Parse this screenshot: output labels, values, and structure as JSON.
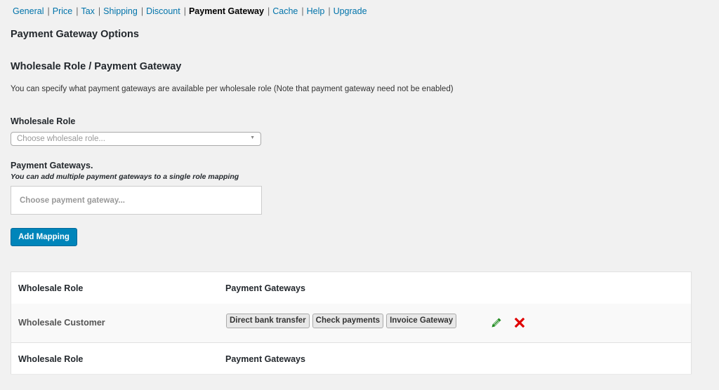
{
  "subnav": {
    "items": [
      {
        "label": "General",
        "current": false
      },
      {
        "label": "Price",
        "current": false
      },
      {
        "label": "Tax",
        "current": false
      },
      {
        "label": "Shipping",
        "current": false
      },
      {
        "label": "Discount",
        "current": false
      },
      {
        "label": "Payment Gateway",
        "current": true
      },
      {
        "label": "Cache",
        "current": false
      },
      {
        "label": "Help",
        "current": false
      },
      {
        "label": "Upgrade",
        "current": false
      }
    ],
    "separator": "|"
  },
  "page": {
    "title": "Payment Gateway Options",
    "section_title": "Wholesale Role / Payment Gateway",
    "description": "You can specify what payment gateways are available per wholesale role (Note that payment gateway need not be enabled)"
  },
  "form": {
    "role_label": "Wholesale Role",
    "role_placeholder": "Choose wholesale role...",
    "gateways_label": "Payment Gateways.",
    "gateways_hint": "You can add multiple payment gateways to a single role mapping",
    "gateways_placeholder": "Choose payment gateway...",
    "add_button": "Add Mapping"
  },
  "table": {
    "columns": [
      "Wholesale Role",
      "Payment Gateways"
    ],
    "rows": [
      {
        "role": "Wholesale Customer",
        "gateways": [
          "Direct bank transfer",
          "Check payments",
          "Invoice Gateway"
        ],
        "actions": [
          "edit-icon",
          "delete-icon"
        ]
      }
    ],
    "footer_columns": [
      "Wholesale Role",
      "Payment Gateways"
    ]
  },
  "colors": {
    "link": "#0073aa",
    "primary_button": "#0085ba",
    "edit_icon": "#1e8a1e",
    "delete_icon": "#e00000"
  }
}
